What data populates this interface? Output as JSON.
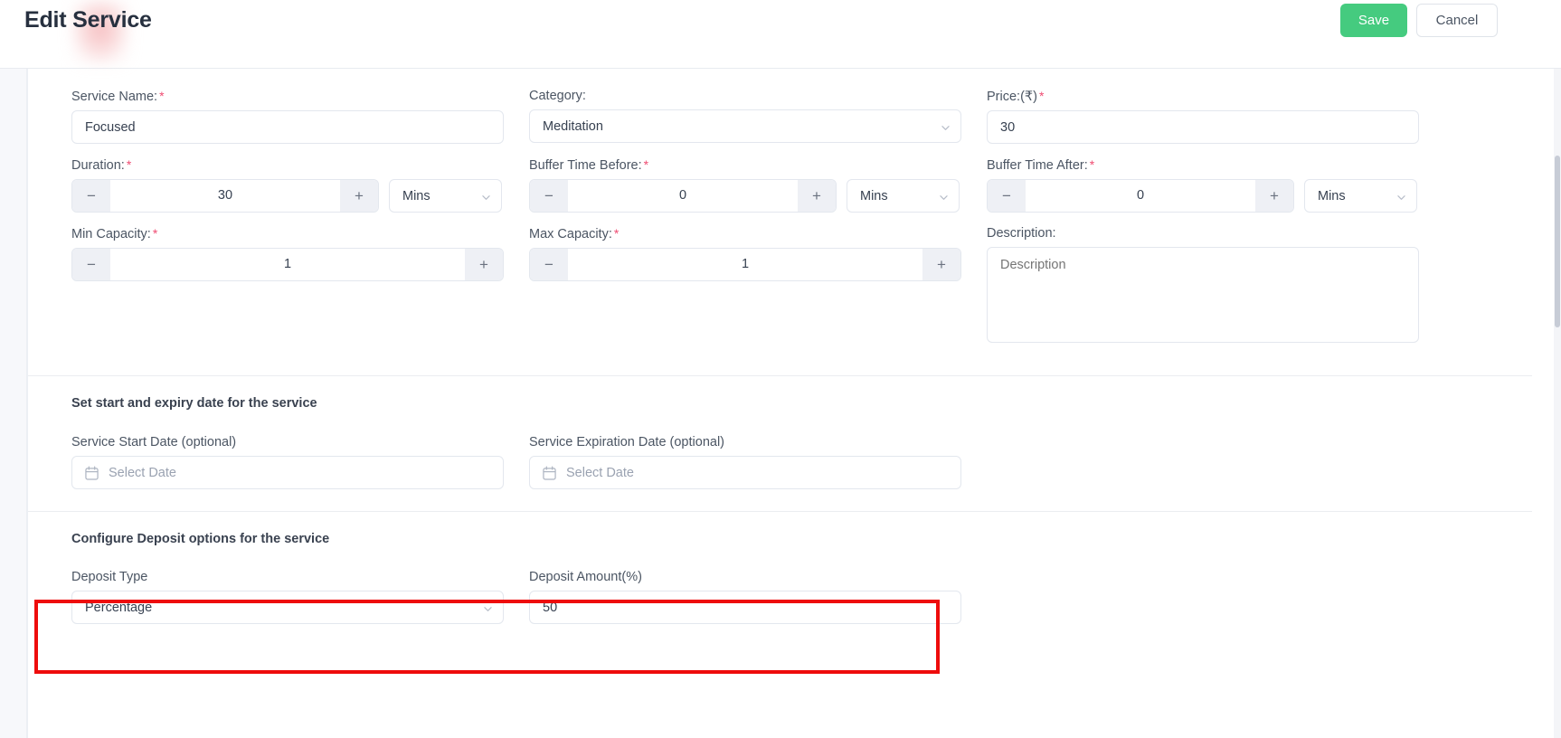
{
  "header": {
    "title": "Edit Service",
    "save_label": "Save",
    "cancel_label": "Cancel"
  },
  "form": {
    "service_name": {
      "label": "Service Name:",
      "required": "*",
      "value": "Focused"
    },
    "category": {
      "label": "Category:",
      "value": "Meditation"
    },
    "price": {
      "label": "Price:(₹)",
      "required": "*",
      "value": "30"
    },
    "duration": {
      "label": "Duration:",
      "required": "*",
      "value": "30",
      "unit": "Mins",
      "minus": "−",
      "plus": "+"
    },
    "buffer_before": {
      "label": "Buffer Time Before:",
      "required": "*",
      "value": "0",
      "unit": "Mins",
      "minus": "−",
      "plus": "+"
    },
    "buffer_after": {
      "label": "Buffer Time After:",
      "required": "*",
      "value": "0",
      "unit": "Mins",
      "minus": "−",
      "plus": "+"
    },
    "min_capacity": {
      "label": "Min Capacity:",
      "required": "*",
      "value": "1",
      "minus": "−",
      "plus": "+"
    },
    "max_capacity": {
      "label": "Max Capacity:",
      "required": "*",
      "value": "1",
      "minus": "−",
      "plus": "+"
    },
    "description": {
      "label": "Description:",
      "placeholder": "Description",
      "value": ""
    }
  },
  "date_section": {
    "title": "Set start and expiry date for the service",
    "start_date": {
      "label": "Service Start Date (optional)",
      "placeholder": "Select Date"
    },
    "expiration_date": {
      "label": "Service Expiration Date (optional)",
      "placeholder": "Select Date"
    }
  },
  "deposit_section": {
    "title": "Configure Deposit options for the service",
    "deposit_type": {
      "label": "Deposit Type",
      "value": "Percentage"
    },
    "deposit_amount": {
      "label": "Deposit Amount(%)",
      "value": "50"
    }
  },
  "icons": {
    "chevron": "chevron-down-icon",
    "calendar": "calendar-icon"
  },
  "colors": {
    "save_green": "#45cb7f",
    "required_red": "#ef4c72",
    "annotation_red": "#ee0c0c"
  }
}
